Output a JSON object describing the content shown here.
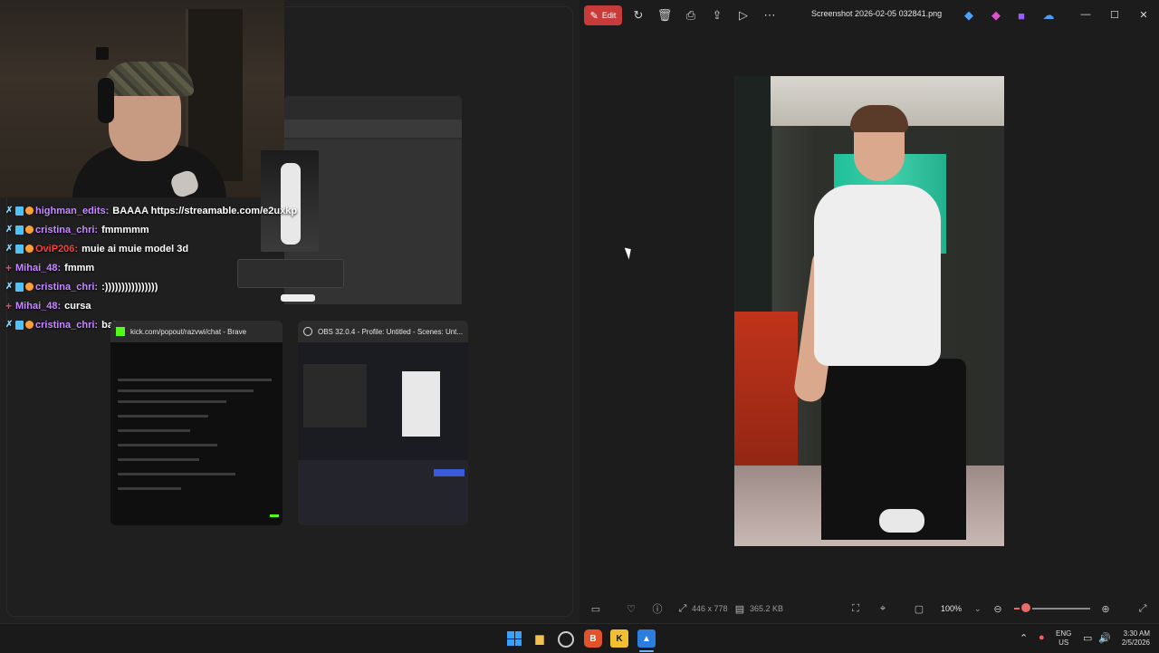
{
  "chat": {
    "lines": [
      {
        "user": "highman_edits:",
        "message": "BAAAA https://streamable.com/e2uxkp",
        "user_color": "#c58aff",
        "badges": "full"
      },
      {
        "user": "cristina_chri:",
        "message": "fmmmmm",
        "user_color": "#c58aff",
        "badges": "full"
      },
      {
        "user": "OviP206:",
        "message": "muie ai muie model 3d",
        "user_color": "#ff3b3b",
        "badges": "full"
      },
      {
        "user": "Mihai_48:",
        "message": "fmmm",
        "user_color": "#c58aff",
        "badges": "plus"
      },
      {
        "user": "cristina_chri:",
        "message": ":))))))))))))))))",
        "user_color": "#c58aff",
        "badges": "full"
      },
      {
        "user": "Mihai_48:",
        "message": "cursa",
        "user_color": "#c58aff",
        "badges": "plus"
      },
      {
        "user": "cristina_chri:",
        "message": "bahahah",
        "user_color": "#c58aff",
        "badges": "full"
      }
    ]
  },
  "thumbnails": {
    "kick": {
      "title": "kick.com/popout/razvwi/chat - Brave"
    },
    "obs": {
      "title": "OBS 32.0.4 - Profile: Untitled - Scenes: Unt..."
    }
  },
  "photos": {
    "edit_label": "Edit",
    "file_title": "Screenshot 2026-02-05 032841.png",
    "dimensions": "446 x 778",
    "file_size": "365.2 KB",
    "zoom": "100%",
    "zoom_level": 0.15
  },
  "toolbar_icons": [
    "rotate-icon",
    "delete-icon",
    "print-icon",
    "share-icon",
    "slideshow-icon",
    "more-icon"
  ],
  "taskbar": {
    "lang_top": "ENG",
    "lang_bottom": "US",
    "time": "3:30 AM",
    "date": "2/5/2026"
  },
  "colors": {
    "accent_edit": "#c73b3b",
    "zoom_accent": "#e86a6a",
    "taskbar_bg": "#1a1a1a"
  }
}
